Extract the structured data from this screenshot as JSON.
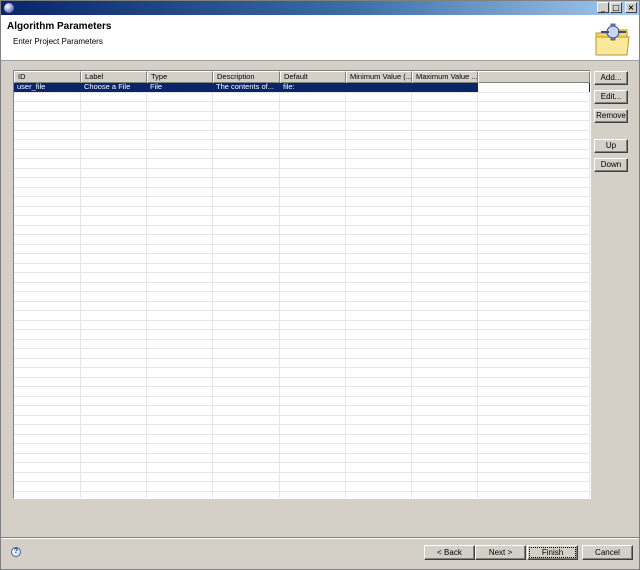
{
  "window": {
    "buttons": {
      "minimize": "_",
      "maximize": "□",
      "close": "×"
    }
  },
  "header": {
    "title": "Algorithm Parameters",
    "subtitle": "Enter Project Parameters",
    "icon": "folder-plug-icon"
  },
  "table": {
    "columns": [
      "ID",
      "Label",
      "Type",
      "Description",
      "Default",
      "Minimum Value (...",
      "Maximum Value ..."
    ],
    "rows": [
      {
        "id": "user_file",
        "label": "Choose a File",
        "type": "File",
        "description": "The contents of...",
        "default": "file:",
        "min": "",
        "max": "",
        "selected": true
      }
    ]
  },
  "side_buttons": {
    "add": "Add...",
    "edit": "Edit...",
    "remove": "Remove",
    "up": "Up",
    "down": "Down"
  },
  "footer": {
    "help_icon": "help-icon",
    "back": "< Back",
    "next": "Next >",
    "finish": "Finish",
    "cancel": "Cancel"
  },
  "colors": {
    "selection": "#0a246a",
    "title_bar": "#0a246a",
    "window_bg": "#d4d0c8"
  }
}
